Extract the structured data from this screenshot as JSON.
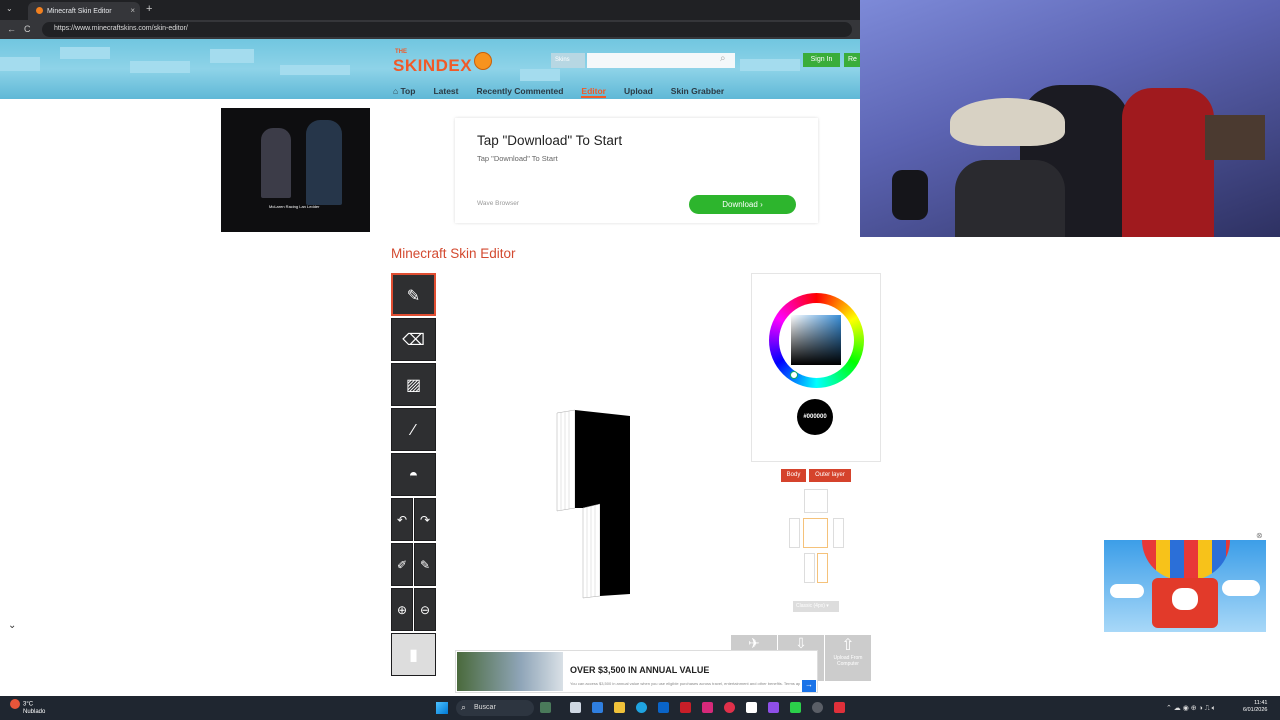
{
  "browser": {
    "tab_title": "Minecraft Skin Editor",
    "tab_close": "×",
    "new_tab": "+",
    "url": "https://www.minecraftskins.com/skin-editor/",
    "back": "←",
    "reload": "C"
  },
  "site": {
    "logo_the": "THE",
    "logo": "SKINDEX",
    "search_category": "Skins",
    "search_placeholder": "",
    "sign_in": "Sign In",
    "register": "Re",
    "nav": [
      {
        "label": "Top",
        "icon": "home-icon"
      },
      {
        "label": "Latest"
      },
      {
        "label": "Recently Commented"
      },
      {
        "label": "Editor"
      },
      {
        "label": "Upload"
      },
      {
        "label": "Skin Grabber"
      }
    ]
  },
  "video_ad": {
    "caption": "McLaren Racing Lan Ledder"
  },
  "ad": {
    "title": "Tap \"Download\" To Start",
    "subtitle": "Tap \"Download\" To Start",
    "brand": "Wave Browser",
    "button": "Download"
  },
  "editor": {
    "title": "Minecraft Skin Editor",
    "tools": [
      "pencil-icon",
      "eraser-icon",
      "brush-icon",
      "eyedropper-icon",
      "bucket-icon"
    ],
    "color_hex": "#000000",
    "layer_body": "Body",
    "layer_outer": "Outer layer",
    "model_select": "Classic (4px)",
    "upload_label": "Upload From Computer"
  },
  "bottom_ad": {
    "title": "OVER $3,500 IN ANNUAL VALUE",
    "fine": "You can access $3,500 in annual value when you use eligible purchases across travel, entertainment and other benefits. Terms apply."
  },
  "taskbar": {
    "temp": "3°C",
    "weather": "Nublado",
    "search": "Buscar",
    "time": "11:41",
    "date": "6/01/2026"
  }
}
